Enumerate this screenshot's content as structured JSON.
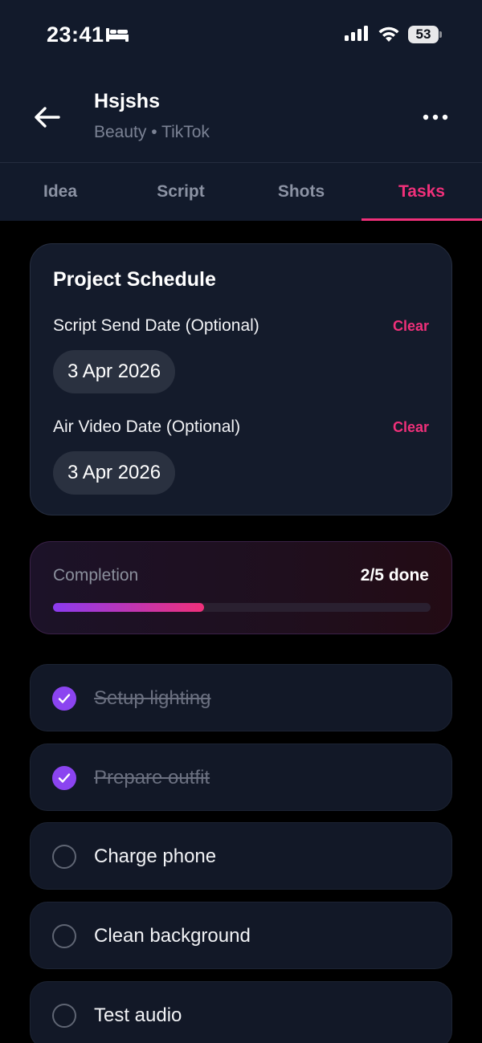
{
  "status_bar": {
    "time": "23:41",
    "battery": "53",
    "icons": [
      "bed-icon",
      "signal-icon",
      "wifi-icon",
      "battery-icon"
    ]
  },
  "header": {
    "title": "Hsjshs",
    "subtitle": "Beauty • TikTok",
    "back_icon": "arrow-left-icon",
    "more_icon": "ellipsis-icon"
  },
  "tabs": [
    {
      "label": "Idea",
      "active": false
    },
    {
      "label": "Script",
      "active": false
    },
    {
      "label": "Shots",
      "active": false
    },
    {
      "label": "Tasks",
      "active": true
    }
  ],
  "schedule": {
    "title": "Project Schedule",
    "script_send": {
      "label": "Script Send Date (Optional)",
      "clear": "Clear",
      "date": "3 Apr 2026"
    },
    "air_video": {
      "label": "Air Video Date (Optional)",
      "clear": "Clear",
      "date": "3 Apr 2026"
    }
  },
  "completion": {
    "label": "Completion",
    "count_text": "2/5 done",
    "done": 2,
    "total": 5
  },
  "tasks": [
    {
      "label": "Setup lighting",
      "done": true
    },
    {
      "label": "Prepare outfit",
      "done": true
    },
    {
      "label": "Charge phone",
      "done": false
    },
    {
      "label": "Clean background",
      "done": false
    },
    {
      "label": "Test audio",
      "done": false
    }
  ],
  "colors": {
    "accent_pink": "#f0307a",
    "accent_purple": "#8b44f0",
    "navy": "#121a2b",
    "background": "#000000"
  }
}
